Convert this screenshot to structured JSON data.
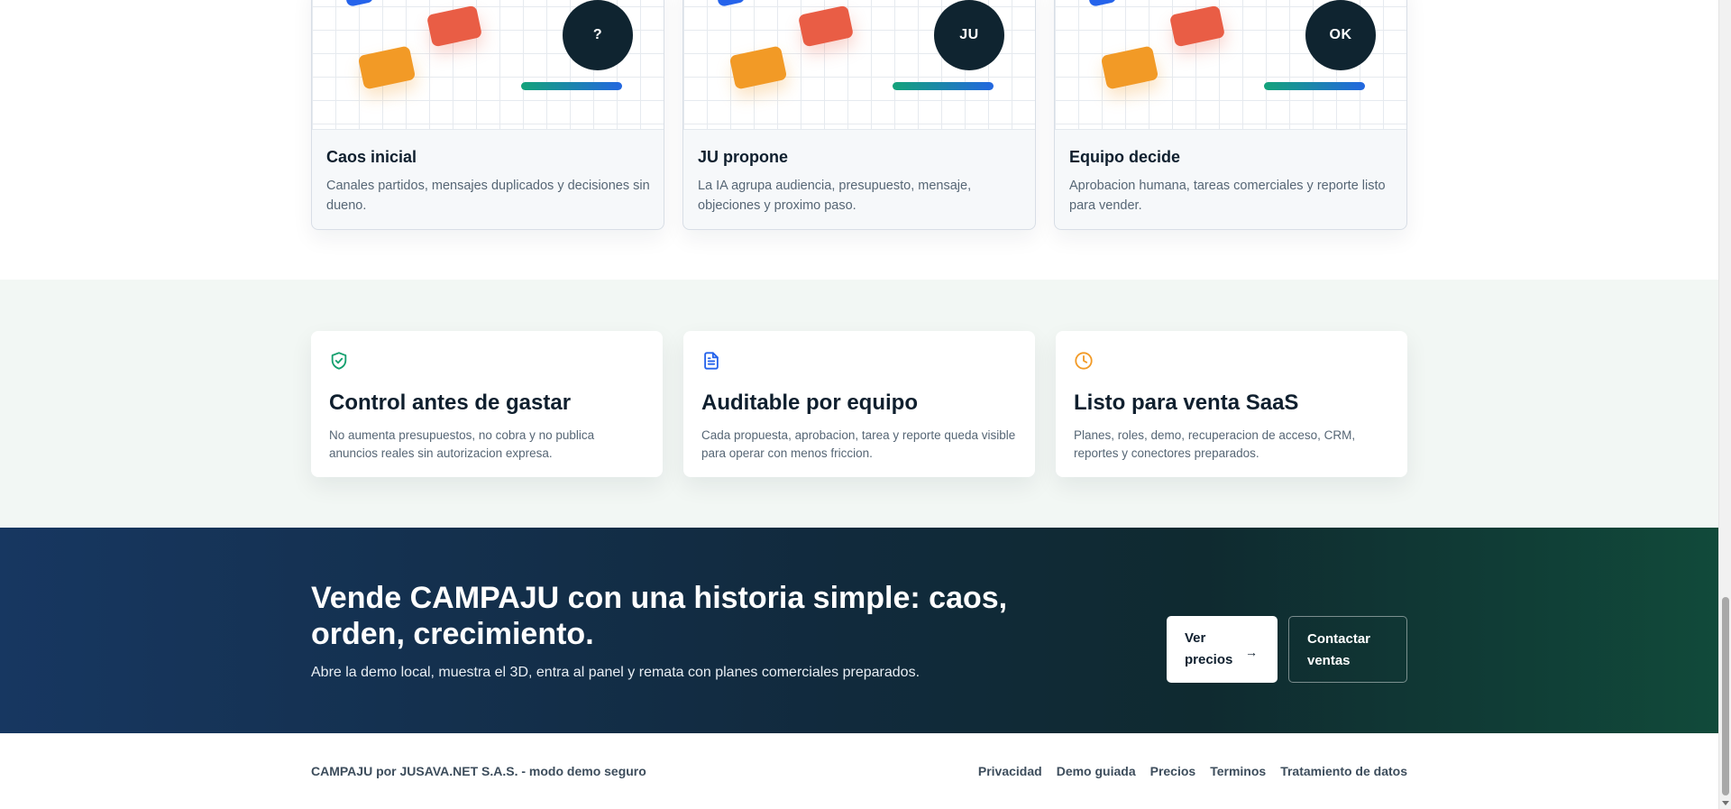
{
  "story": {
    "cards": [
      {
        "badge": "?",
        "title": "Caos inicial",
        "text": "Canales partidos, mensajes duplicados y decisiones sin dueno."
      },
      {
        "badge": "JU",
        "title": "JU propone",
        "text": "La IA agrupa audiencia, presupuesto, mensaje, objeciones y proximo paso."
      },
      {
        "badge": "OK",
        "title": "Equipo decide",
        "text": "Aprobacion humana, tareas comerciales y reporte listo para vender."
      }
    ]
  },
  "features": {
    "cards": [
      {
        "icon": "shield-check-icon",
        "title": "Control antes de gastar",
        "text": "No aumenta presupuestos, no cobra y no publica anuncios reales sin autorizacion expresa."
      },
      {
        "icon": "document-icon",
        "title": "Auditable por equipo",
        "text": "Cada propuesta, aprobacion, tarea y reporte queda visible para operar con menos friccion."
      },
      {
        "icon": "clock-icon",
        "title": "Listo para venta SaaS",
        "text": "Planes, roles, demo, recuperacion de acceso, CRM, reportes y conectores preparados."
      }
    ]
  },
  "cta": {
    "title": "Vende CAMPAJU con una historia simple: caos, orden, crecimiento.",
    "subtitle": "Abre la demo local, muestra el 3D, entra al panel y remata con planes comerciales preparados.",
    "primary_label": "Ver precios",
    "primary_arrow": "→",
    "secondary_label": "Contactar ventas"
  },
  "footer": {
    "brand": "CAMPAJU por JUSAVA.NET S.A.S. - modo demo seguro",
    "links": [
      "Privacidad",
      "Demo guiada",
      "Precios",
      "Terminos",
      "Tratamiento de datos"
    ]
  },
  "colors": {
    "navy": "#0f2430",
    "green": "#15a06f",
    "blue": "#2563eb",
    "orange": "#f29a26",
    "red": "#e95d45",
    "mint_band": "#f2f7f4"
  }
}
